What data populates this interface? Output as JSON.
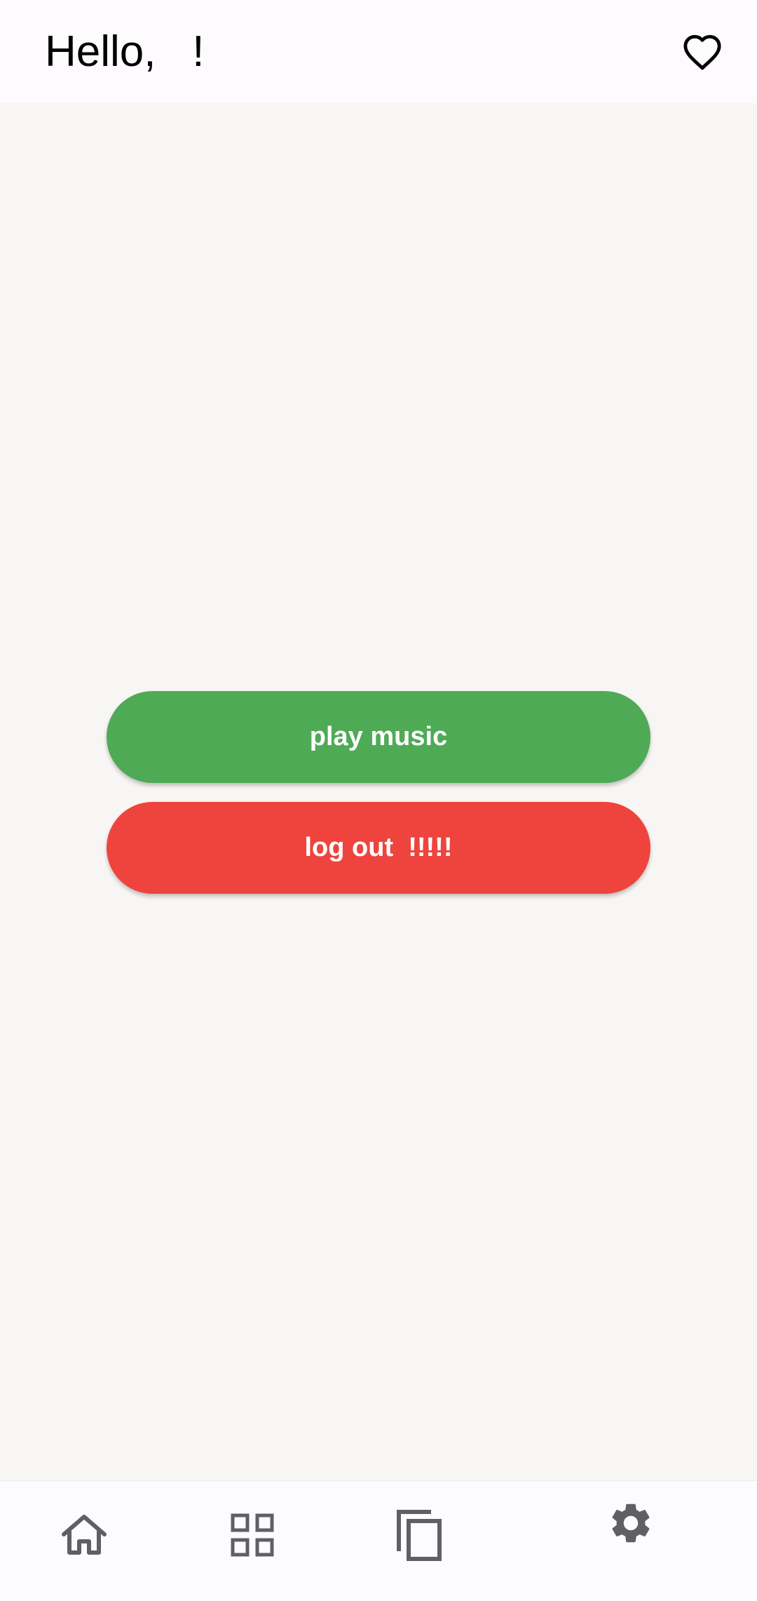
{
  "header": {
    "greeting": "Hello,   !",
    "favorite_icon": "heart-outline-icon"
  },
  "actions": {
    "play_label": "play music",
    "logout_label": "log out  !!!!!"
  },
  "colors": {
    "play_button": "#4faa55",
    "logout_button": "#ee443d",
    "background": "#f7f6f4",
    "nav_icon": "#625f64"
  },
  "bottom_nav": {
    "items": [
      {
        "icon": "home-icon"
      },
      {
        "icon": "grid-icon"
      },
      {
        "icon": "copy-pages-icon"
      },
      {
        "icon": "settings-gear-icon"
      }
    ]
  }
}
